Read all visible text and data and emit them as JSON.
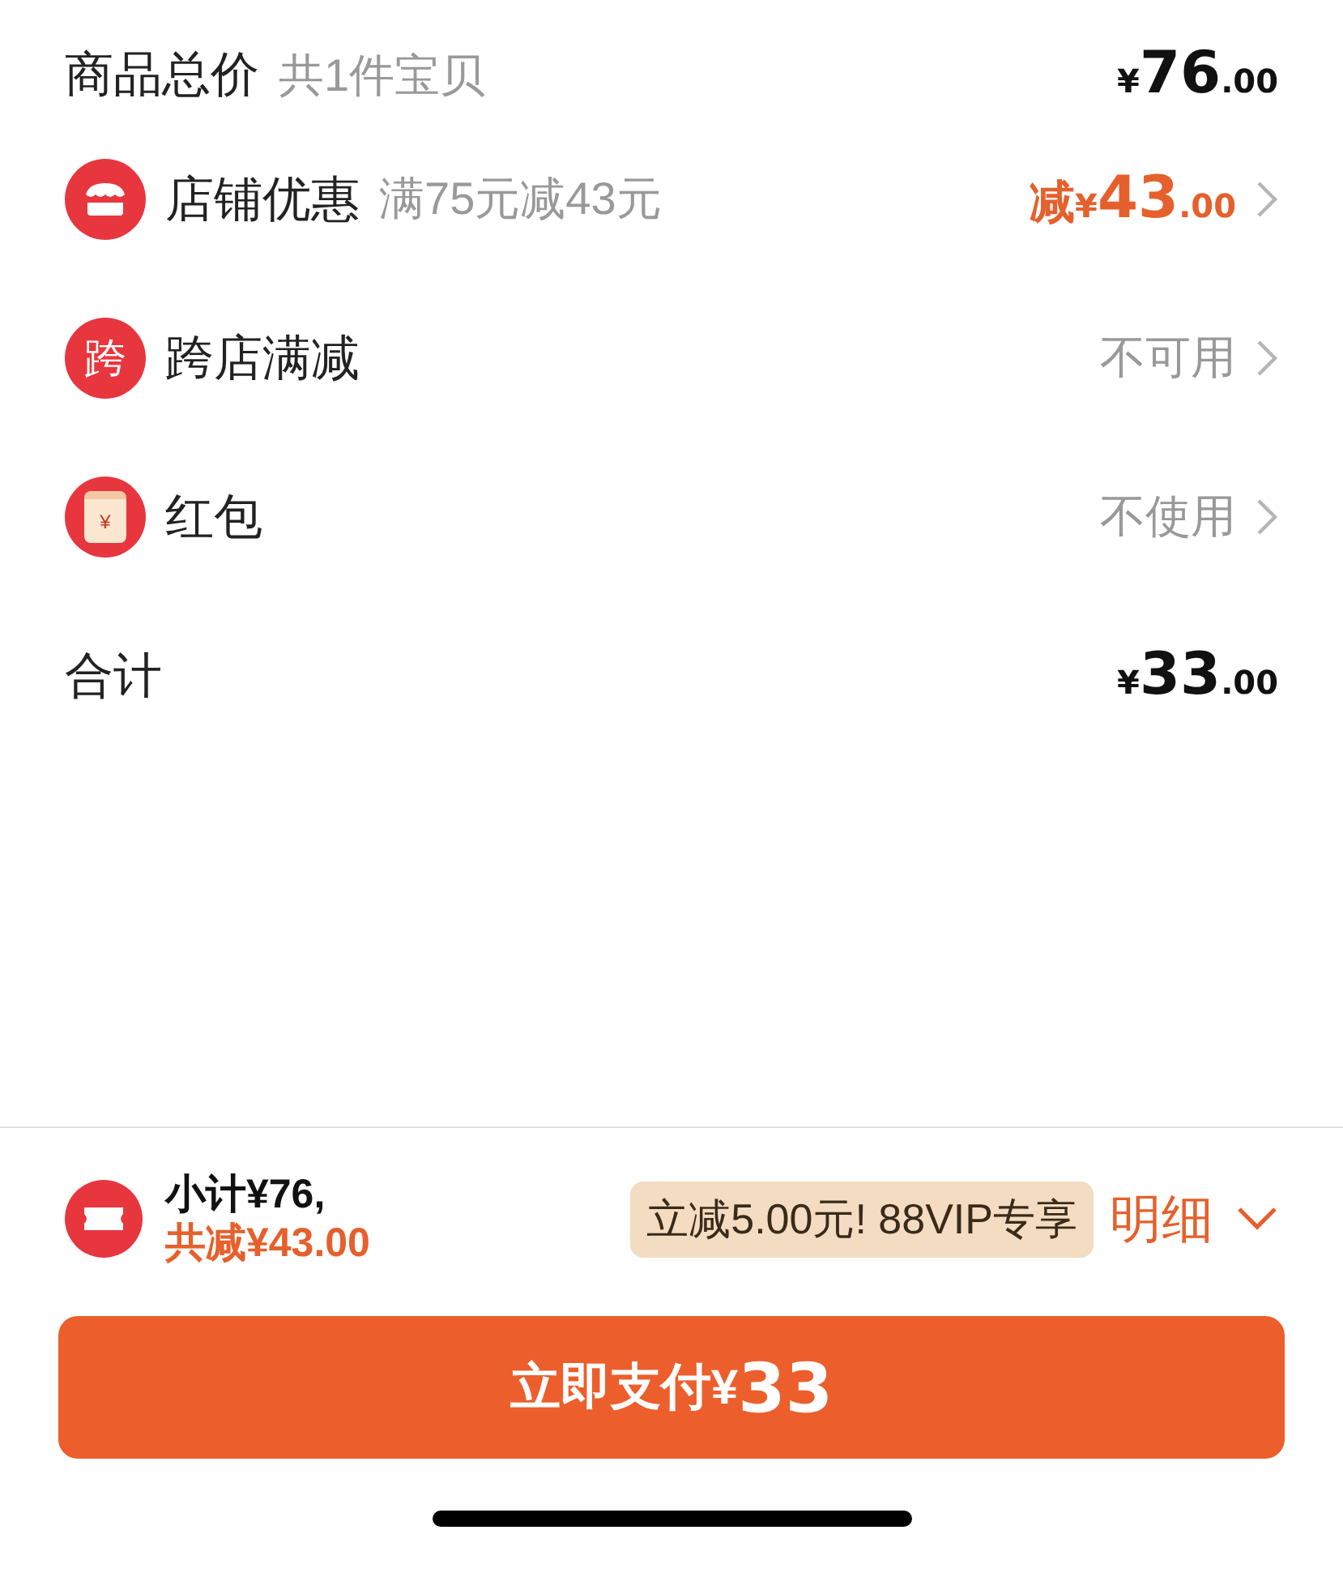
{
  "summary": {
    "label": "商品总价",
    "note": "共1件宝贝",
    "price": {
      "currency": "¥",
      "integer": "76",
      "decimals": ".00"
    }
  },
  "rows": [
    {
      "kind": "store",
      "label": "店铺优惠",
      "note": "满75元减43元",
      "prefix": "减",
      "price": {
        "currency": "¥",
        "integer": "43",
        "decimals": ".00"
      }
    },
    {
      "kind": "cross",
      "icon_text": "跨",
      "label": "跨店满减",
      "value": "不可用"
    },
    {
      "kind": "envelope",
      "icon_text": "¥",
      "label": "红包",
      "value": "不使用"
    }
  ],
  "total": {
    "label": "合计",
    "price": {
      "currency": "¥",
      "integer": "33",
      "decimals": ".00"
    }
  },
  "footer": {
    "subtotal": "小计¥76,",
    "discount": "共减¥43.00",
    "promo": "立减5.00元! 88VIP专享",
    "details": "明细"
  },
  "pay_button": {
    "label": "立即支付",
    "currency": "¥",
    "amount": "33"
  }
}
